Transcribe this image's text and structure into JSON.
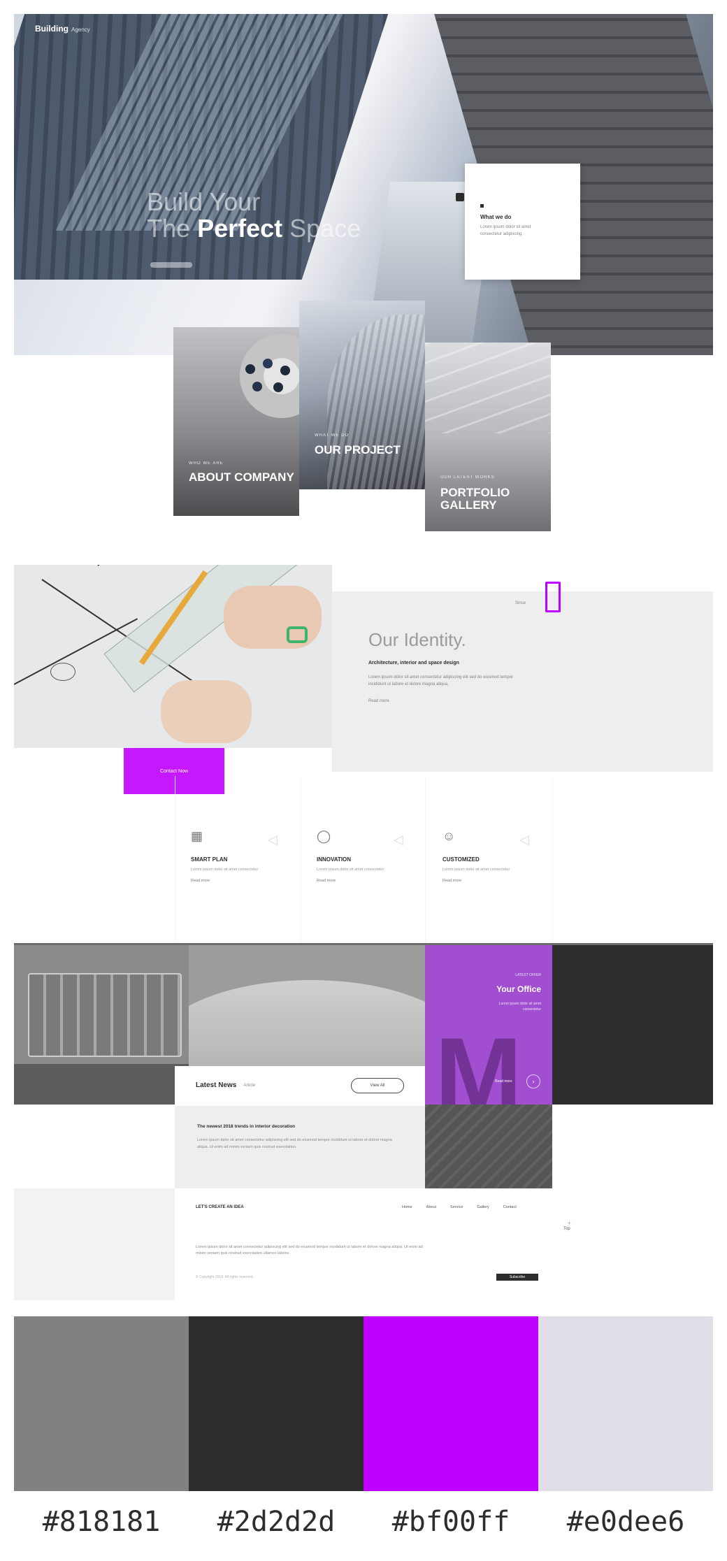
{
  "hero": {
    "brand": "Building",
    "brand_sub": "Agency",
    "headline_line1": "Build Your",
    "headline_prefix": "The",
    "headline_strong": "Perfect",
    "headline_suffix": "Space",
    "card_title": "What we do",
    "card_text": "Lorem ipsum dolor sit amet consectetur adipiscing"
  },
  "services": [
    {
      "pre": "WHO WE ARE",
      "title": "About Company"
    },
    {
      "pre": "WHAT WE DO",
      "title": "Our Project"
    },
    {
      "pre": "OUR LATEST WORKS",
      "title": "Portfolio Gallery"
    }
  ],
  "identity": {
    "badge_label": "Since",
    "heading": "Our Identity.",
    "subheading": "Architecture, interior and space design",
    "body": "Lorem ipsum dolor sit amet consectetur adipiscing elit sed do eiusmod tempor incididunt ut labore et dolore magna aliqua.",
    "more": "Read more",
    "button": "Contact Now"
  },
  "features": [
    {
      "icon": "blueprint-icon",
      "title": "SMART PLAN",
      "desc": "Lorem ipsum dolor sit amet consectetur",
      "more": "Read more"
    },
    {
      "icon": "lightbulb-icon",
      "title": "INNOVATION",
      "desc": "Lorem ipsum dolor sit amet consectetur",
      "more": "Read more"
    },
    {
      "icon": "customer-icon",
      "title": "CUSTOMIZED",
      "desc": "Lorem ipsum dolor sit amet consectetur",
      "more": "Read more"
    }
  ],
  "promo": {
    "pre": "LATEST OFFER",
    "title": "Your Office",
    "desc": "Lorem ipsum dolor sit amet consectetur",
    "more": "Read more",
    "big_letter": "M"
  },
  "news": {
    "title": "Latest News",
    "subtitle": "Article",
    "button": "View All",
    "item_title": "The newest 2018 trends in interior decoration",
    "item_body": "Lorem ipsum dolor sit amet consectetur adipiscing elit sed do eiusmod tempor incididunt ut labore et dolore magna aliqua. Ut enim ad minim veniam quis nostrud exercitation."
  },
  "footer": {
    "heading": "LET'S CREATE AN IDEA",
    "links": [
      "Home",
      "About",
      "Service",
      "Gallery",
      "Contact"
    ],
    "paragraph": "Lorem ipsum dolor sit amet consectetur adipiscing elit sed do eiusmod tempor incididunt ut labore et dolore magna aliqua. Ut enim ad minim veniam quis nostrud exercitation ullamco laboris.",
    "copyright": "© Copyright 2018. All rights reserved.",
    "button": "Subscribe",
    "side_label": "Top"
  },
  "palette": [
    {
      "hex": "#818181",
      "label": "#818181"
    },
    {
      "hex": "#2d2d2d",
      "label": "#2d2d2d"
    },
    {
      "hex": "#bf00ff",
      "label": "#bf00ff"
    },
    {
      "hex": "#e0dee6",
      "label": "#e0dee6"
    }
  ]
}
